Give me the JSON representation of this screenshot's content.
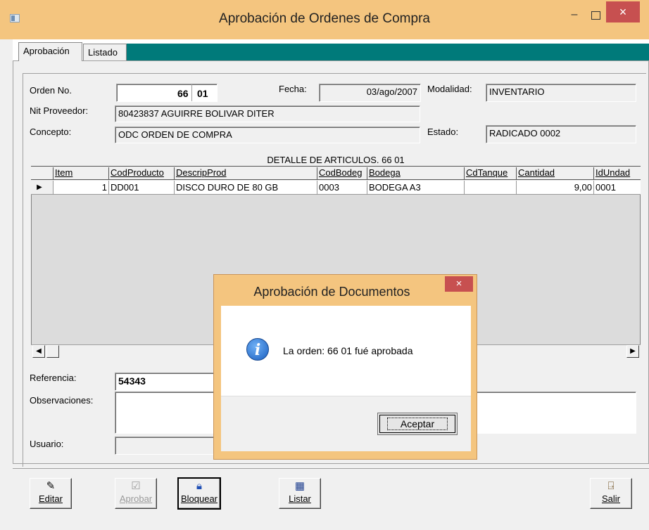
{
  "window": {
    "title": "Aprobación de Ordenes de Compra",
    "minimize": "–",
    "close": "×"
  },
  "tabs": [
    {
      "label": "Aprobación"
    },
    {
      "label": "Listado"
    }
  ],
  "form": {
    "orden_label": "Orden No.",
    "orden_num": "66",
    "orden_suffix": "01",
    "fecha_label": "Fecha:",
    "fecha_value": "03/ago/2007",
    "modalidad_label": "Modalidad:",
    "modalidad_value": "INVENTARIO",
    "nit_label": "Nit Proveedor:",
    "nit_value": "80423837 AGUIRRE BOLIVAR DITER",
    "concepto_label": "Concepto:",
    "concepto_value": "ODC ORDEN DE COMPRA",
    "estado_label": "Estado:",
    "estado_value": "RADICADO 0002",
    "referencia_label": "Referencia:",
    "referencia_value": "54343",
    "observaciones_label": "Observaciones:",
    "usuario_label": "Usuario:"
  },
  "grid": {
    "title": "DETALLE DE ARTICULOS. 66 01",
    "headers": [
      "Item",
      "CodProducto",
      "DescripProd",
      "CodBodeg",
      "Bodega",
      "CdTanque",
      "Cantidad",
      "IdUndad"
    ],
    "rows": [
      [
        "1",
        "DD001",
        "DISCO DURO DE 80 GB",
        "0003",
        "BODEGA A3",
        "",
        "9,00",
        "0001"
      ]
    ]
  },
  "toolbar": {
    "editar": "Editar",
    "aprobar": "Aprobar",
    "bloquear": "Bloquear",
    "listar": "Listar",
    "salir": "Salir"
  },
  "dialog": {
    "title": "Aprobación de Documentos",
    "close": "×",
    "message": "La orden: 66 01 fué aprobada",
    "ok": "Aceptar"
  },
  "colors": {
    "title_bar": "#f4c57f",
    "tab_strip": "#007a7a",
    "close_button": "#c75050"
  }
}
